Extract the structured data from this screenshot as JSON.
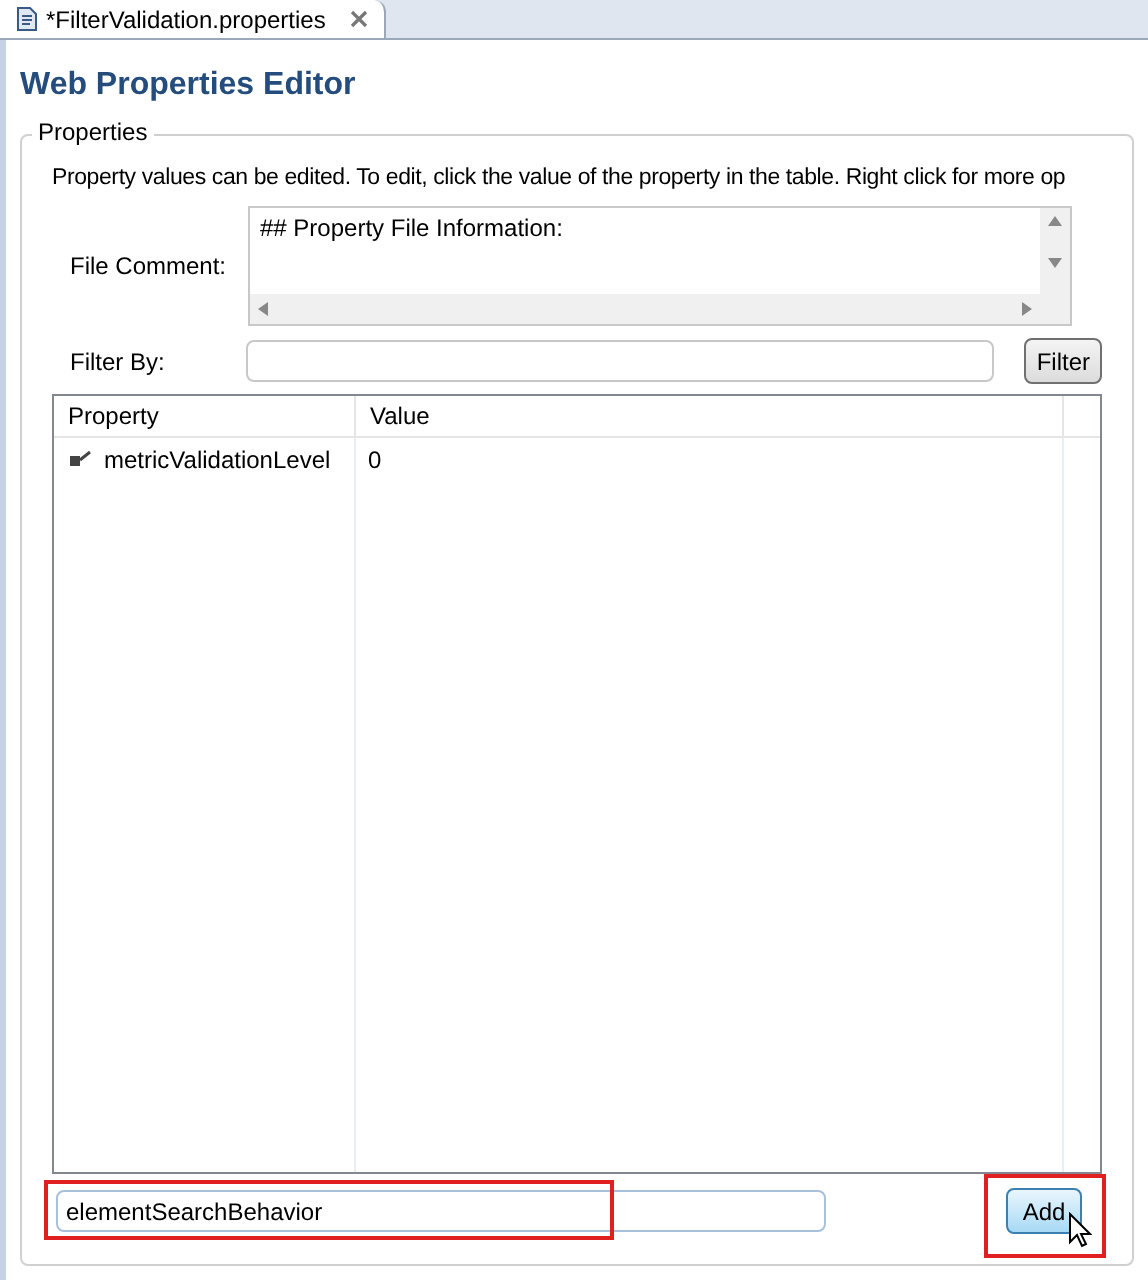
{
  "tab": {
    "title": "*FilterValidation.properties"
  },
  "editor_title": "Web Properties Editor",
  "group": {
    "title": "Properties",
    "description": "Property values can be edited. To edit, click the value of the property in the table. Right click for more op"
  },
  "file_comment": {
    "label": "File Comment:",
    "value": "## Property File Information:"
  },
  "filter": {
    "label": "Filter By:",
    "button": "Filter"
  },
  "table": {
    "columns": [
      "Property",
      "Value"
    ],
    "rows": [
      {
        "property": "metricValidationLevel",
        "value": "0"
      }
    ]
  },
  "add": {
    "value": "elementSearchBehavior",
    "button": "Add",
    "highlighted": true
  }
}
